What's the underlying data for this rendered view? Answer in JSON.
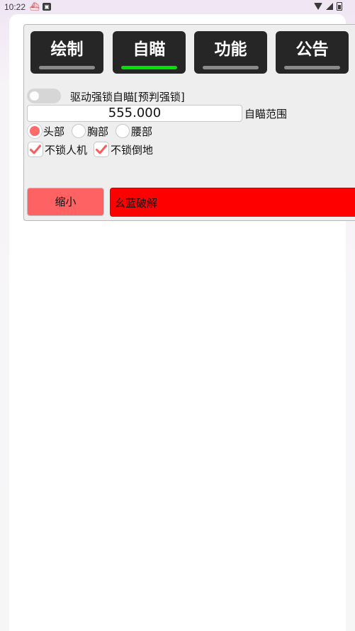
{
  "status_bar": {
    "time": "10:22",
    "icons": [
      "notification-app-icon",
      "notification-gallery-icon",
      "wifi-icon",
      "signal-icon",
      "battery-icon"
    ]
  },
  "tabs": [
    {
      "label": "绘制",
      "active": false
    },
    {
      "label": "自瞄",
      "active": true
    },
    {
      "label": "功能",
      "active": false
    },
    {
      "label": "公告",
      "active": false
    }
  ],
  "aimbot": {
    "driver_lock_label": "驱动强锁自瞄[预判强锁]",
    "driver_lock_enabled": false,
    "range_value": "555.000",
    "range_label": "自瞄范围",
    "targets": [
      {
        "label": "头部",
        "checked": true
      },
      {
        "label": "胸部",
        "checked": false
      },
      {
        "label": "腰部",
        "checked": false
      }
    ],
    "options": [
      {
        "label": "不锁人机",
        "checked": true
      },
      {
        "label": "不锁倒地",
        "checked": true
      }
    ]
  },
  "footer": {
    "shrink_label": "缩小",
    "banner_text": "幺蓝破解"
  },
  "colors": {
    "tab_bg": "#262626",
    "tab_active_indicator": "#00e100",
    "tab_inactive_indicator": "#8a8a8a",
    "accent_red": "#ff6262",
    "banner_red": "#ff0000",
    "check_red": "#ff5a5a"
  }
}
